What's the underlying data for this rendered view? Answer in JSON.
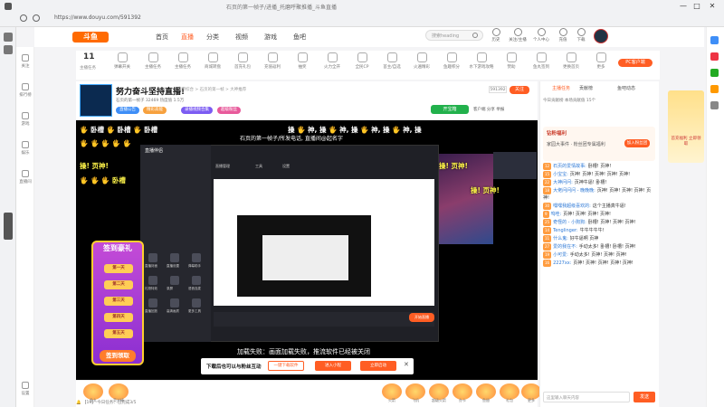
{
  "browser": {
    "tab_title": "石页的第一帧子/进播_托磨呼聚推播_斗鱼直播",
    "url": "https://www.douyu.com/591392",
    "min": "—",
    "max": "□",
    "close": "✕"
  },
  "site_nav": {
    "logo": "斗鱼",
    "items": [
      "首页",
      "直播",
      "分类",
      "视频",
      "游戏",
      "鱼吧"
    ],
    "search_placeholder": "搜索heading",
    "header_icons": [
      "历史",
      "关注/主播",
      "个人中心",
      "充值",
      "下载"
    ]
  },
  "site_left": {
    "items": [
      "关注",
      "排行榜",
      "游戏",
      "娱乐",
      "直播间",
      "设置"
    ]
  },
  "sub_toolbar": {
    "rank_num": "11",
    "rank_label": "主播任务",
    "items": [
      "弹幕开关",
      "主播任务",
      "主播任务",
      "商城转盘",
      "首充礼包",
      "充值返利",
      "抽奖",
      "火力全开",
      "全民CP",
      "首主/自选",
      "火遍精彩",
      "鱼趣积分",
      "水下游戏攻略",
      "赞助",
      "鱼丸签到",
      "更换首页",
      "更多"
    ],
    "pc_button": "PC客户端"
  },
  "room": {
    "title": "努力奋斗坚持直播!",
    "crumb": "网游综合 > 石页的第一帧 > 大神推荐",
    "meta": "石页的第一帧子   32469   热度值 1.5万",
    "tags": [
      "直播公告",
      "精彩高能",
      "录播视频合集",
      "超级粉丝"
    ],
    "room_id": "591392",
    "follow": "关注",
    "treasure": "开宝箱",
    "actions": "客户端 分享 举报"
  },
  "video": {
    "danmaku": [
      {
        "text": "🖐 卧槽  🖐 卧槽  🖐 卧槽",
        "cls": "y"
      },
      {
        "text": "操  🖐 神, 操  🖐 神, 操  🖐 神, 操  🖐 神, 操",
        "cls": ""
      },
      {
        "text": "🖐  🖐  🖐  🖐  🖐",
        "cls": "y"
      },
      {
        "text": "操! 页神!",
        "cls": "y"
      },
      {
        "text": "🖐 🖐 🖐 卧槽",
        "cls": "y"
      }
    ],
    "overlay_caption": "石页的第一帧子/所发电话, 直播间@起名字",
    "app_title": "直播伴侣",
    "app_tabs": [
      "直播管理",
      "工具",
      "设置"
    ],
    "app_side_items": [
      "直播封面",
      "直播设置",
      "弹幕助手",
      "礼物特效",
      "录屏",
      "语音连麦",
      "直播回放",
      "高清画质",
      "更多工具"
    ],
    "go_live": "开始直播",
    "load_fail": "加载失败：画面加载失败，推流软件已经被关闭",
    "signin": {
      "title": "签到豪礼",
      "days": [
        "第一天",
        "第二天",
        "第三天",
        "第四天",
        "第五天"
      ],
      "button": "签到领取"
    },
    "promo": {
      "text": "下载后也可以与粉丝互动",
      "btn1": "一键下载软件",
      "btn2": "进入小程",
      "btn3": "立即启动",
      "close": "✕"
    }
  },
  "gift_bar": {
    "gifts": [
      "鱼丸",
      "荧光棒",
      "火箭",
      "飞机",
      "超级火箭",
      "办卡",
      "鱼翅",
      "礼包",
      "更多"
    ],
    "bottom": "🔔  【19】 今日任务：已完成3/5"
  },
  "right_panel": {
    "tabs": [
      "主播任务",
      "贡献榜",
      "鱼吧动态"
    ],
    "rank_text": "今日贡献榜   本场贡献值 15个",
    "fan_title": "钻粉福利",
    "fan_sub": "家园大事件 · 粉丝团专属福利",
    "join_fan": "加入粉丝团",
    "chat": [
      {
        "lvl": "12",
        "name": "石页的爱情故事:",
        "text": "卧槽! 页神!"
      },
      {
        "lvl": "15",
        "name": "小宝宝:",
        "text": "页神! 页神! 页神! 页神! 页神!"
      },
      {
        "lvl": "22",
        "name": "大神问问:",
        "text": "页神牛逼! 卧槽!"
      },
      {
        "lvl": "18",
        "name": "大佬问问问 - 晚晚晚:",
        "text": "页神! 页神! 页神! 页神! 页神!"
      },
      {
        "lvl": "30",
        "name": "嘿嘿我超级喜欢的:",
        "text": "这个主播真牛逼!"
      },
      {
        "lvl": "9",
        "name": "呜哇:",
        "text": "页神! 页神! 页神! 页神!"
      },
      {
        "lvl": "25",
        "name": "奇怪的 - 小狗狗:",
        "text": "卧槽! 页神! 页神! 页神!"
      },
      {
        "lvl": "14",
        "name": "Tenglinger:",
        "text": "牛牛牛牛牛!"
      },
      {
        "lvl": "11",
        "name": "什么鬼:",
        "text": "好牛逼啊 页神"
      },
      {
        "lvl": "27",
        "name": "爱的我在不:",
        "text": "手动太多! 卧槽! 卧槽! 页神!"
      },
      {
        "lvl": "19",
        "name": "小可爱:",
        "text": "手动太多! 页神! 页神! 页神!"
      },
      {
        "lvl": "16",
        "name": "2227xx:",
        "text": "页神! 页神! 页神! 页神! 页神!"
      }
    ],
    "input_placeholder": "这里输入聊天内容",
    "send": "发送"
  },
  "right_ad": {
    "text": "首充福利 立即领取"
  },
  "colors": {
    "accent": "#ff5d23",
    "danmaku_yellow": "#fff54a"
  }
}
